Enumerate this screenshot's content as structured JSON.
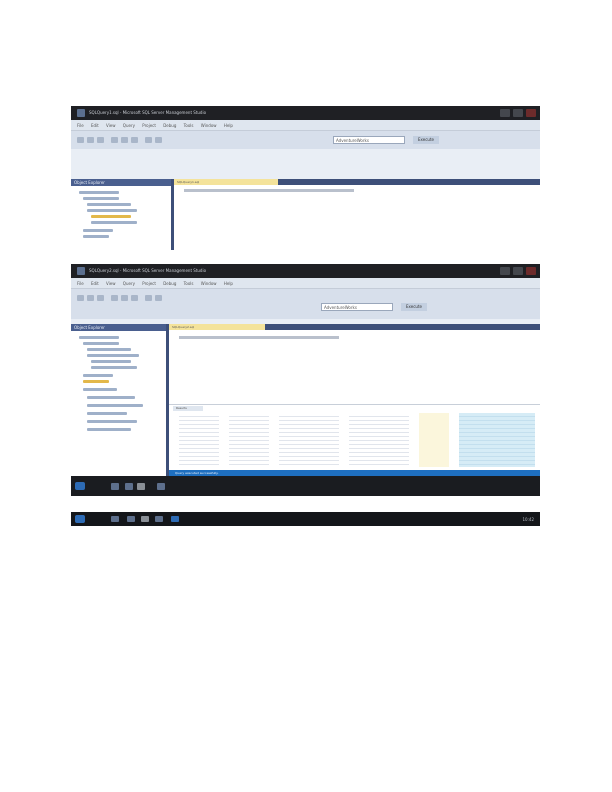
{
  "window_top": {
    "title": "SQLQuery1.sql - Microsoft SQL Server Management Studio",
    "menu": [
      "File",
      "Edit",
      "View",
      "Query",
      "Project",
      "Debug",
      "Tools",
      "Window",
      "Help"
    ],
    "database": "AdventureWorks",
    "execute_label": "Execute",
    "object_explorer_title": "Object Explorer",
    "tab_label": "SQLQuery1.sql"
  },
  "window_bottom": {
    "title": "SQLQuery2.sql - Microsoft SQL Server Management Studio",
    "menu": [
      "File",
      "Edit",
      "View",
      "Query",
      "Project",
      "Debug",
      "Tools",
      "Window",
      "Help"
    ],
    "database": "AdventureWorks",
    "execute_label": "Execute",
    "object_explorer_title": "Object Explorer",
    "tab_label": "SQLQuery2.sql",
    "results_label": "Results",
    "status_text": "Query executed successfully."
  },
  "taskbar": {
    "clock": "10:42"
  },
  "colors": {
    "titlebar": "#1f2024",
    "accent": "#3d4f79",
    "status": "#1e6fc0",
    "tab": "#f4e39b"
  }
}
